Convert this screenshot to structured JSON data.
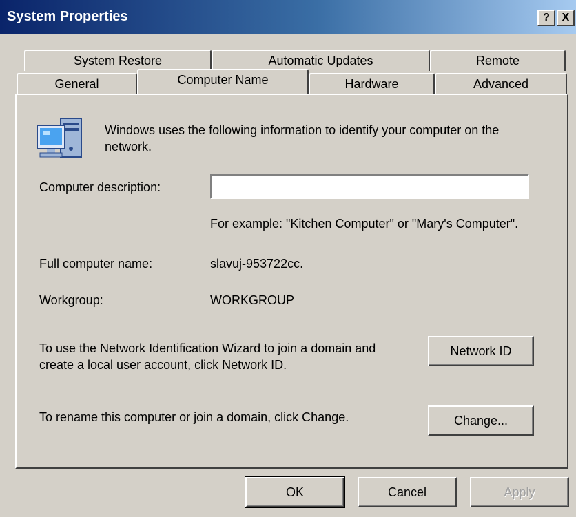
{
  "window": {
    "title": "System Properties",
    "help_label": "?",
    "close_label": "X"
  },
  "tabs_row_back": [
    {
      "label": "System Restore"
    },
    {
      "label": "Automatic Updates"
    },
    {
      "label": "Remote"
    }
  ],
  "tabs_row_front": [
    {
      "label": "General"
    },
    {
      "label": "Computer Name",
      "selected": true
    },
    {
      "label": "Hardware"
    },
    {
      "label": "Advanced"
    }
  ],
  "content": {
    "intro": "Windows uses the following information to identify your computer on the network.",
    "description_label": "Computer description:",
    "description_value": "",
    "example_text": "For example: \"Kitchen Computer\" or \"Mary's Computer\".",
    "full_name_label": "Full computer name:",
    "full_name_value": "slavuj-953722cc.",
    "workgroup_label": "Workgroup:",
    "workgroup_value": "WORKGROUP",
    "network_id_text": "To use the Network Identification Wizard to join a domain and create a local user account, click Network ID.",
    "network_id_button": "Network ID",
    "rename_text": "To rename this computer or join a domain, click Change.",
    "change_button": "Change..."
  },
  "footer": {
    "ok_label": "OK",
    "cancel_label": "Cancel",
    "apply_label": "Apply",
    "apply_enabled": false
  },
  "icons": {
    "computer_icon": "computer-network-icon"
  },
  "colors": {
    "titlebar_start": "#0a246a",
    "titlebar_end": "#a6caf0",
    "face": "#d4d0c8"
  }
}
